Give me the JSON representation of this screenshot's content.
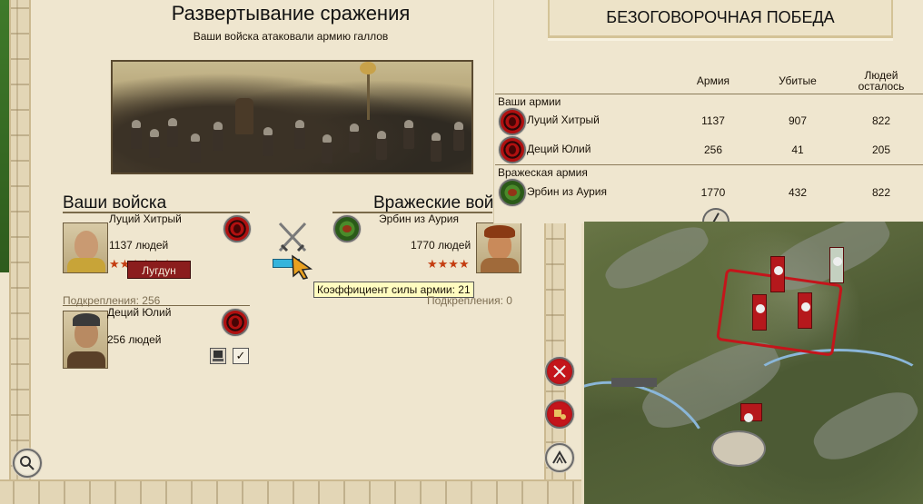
{
  "header": {
    "title": "Развертывание сражения",
    "subtitle": "Ваши войска атаковали армию галлов"
  },
  "player": {
    "heading": "Ваши войска",
    "general": {
      "name": "Луций Хитрый",
      "men": "1137 людей",
      "stars": "★★★★★★"
    },
    "reinforcements_label": "Подкрепления: 256",
    "reinforcement": {
      "name": "Деций Юлий",
      "men": "256 людей"
    }
  },
  "enemy": {
    "heading": "Вражеские вой",
    "general": {
      "name": "Эрбин из Аурия",
      "men": "1770 людей",
      "stars": "★★★★"
    },
    "reinforcements_label": "Подкрепления: 0"
  },
  "tooltip": {
    "text": "Коэффициент силы армии: 21"
  },
  "result": {
    "banner": "БЕЗОГОВОРОЧНАЯ ПОБЕДА",
    "columns": [
      "Армия",
      "Убитые",
      "Людей осталось"
    ],
    "player_section": "Ваши армии",
    "player_rows": [
      {
        "name": "Луций Хитрый",
        "army": "1137",
        "killed": "907",
        "left": "822"
      },
      {
        "name": "Деций Юлий",
        "army": "256",
        "killed": "41",
        "left": "205"
      }
    ],
    "enemy_section": "Вражеская армия",
    "enemy_rows": [
      {
        "name": "Эрбин из Аурия",
        "army": "1770",
        "killed": "432",
        "left": "822"
      }
    ]
  },
  "map": {
    "city_name": "Лугдун"
  },
  "colors": {
    "parchment": "#efe6cf",
    "roman_red": "#b01010",
    "gaul_green": "#4a8a2a",
    "tooltip_bg": "#fffcc0",
    "strength_bar": "#35b4dc"
  }
}
